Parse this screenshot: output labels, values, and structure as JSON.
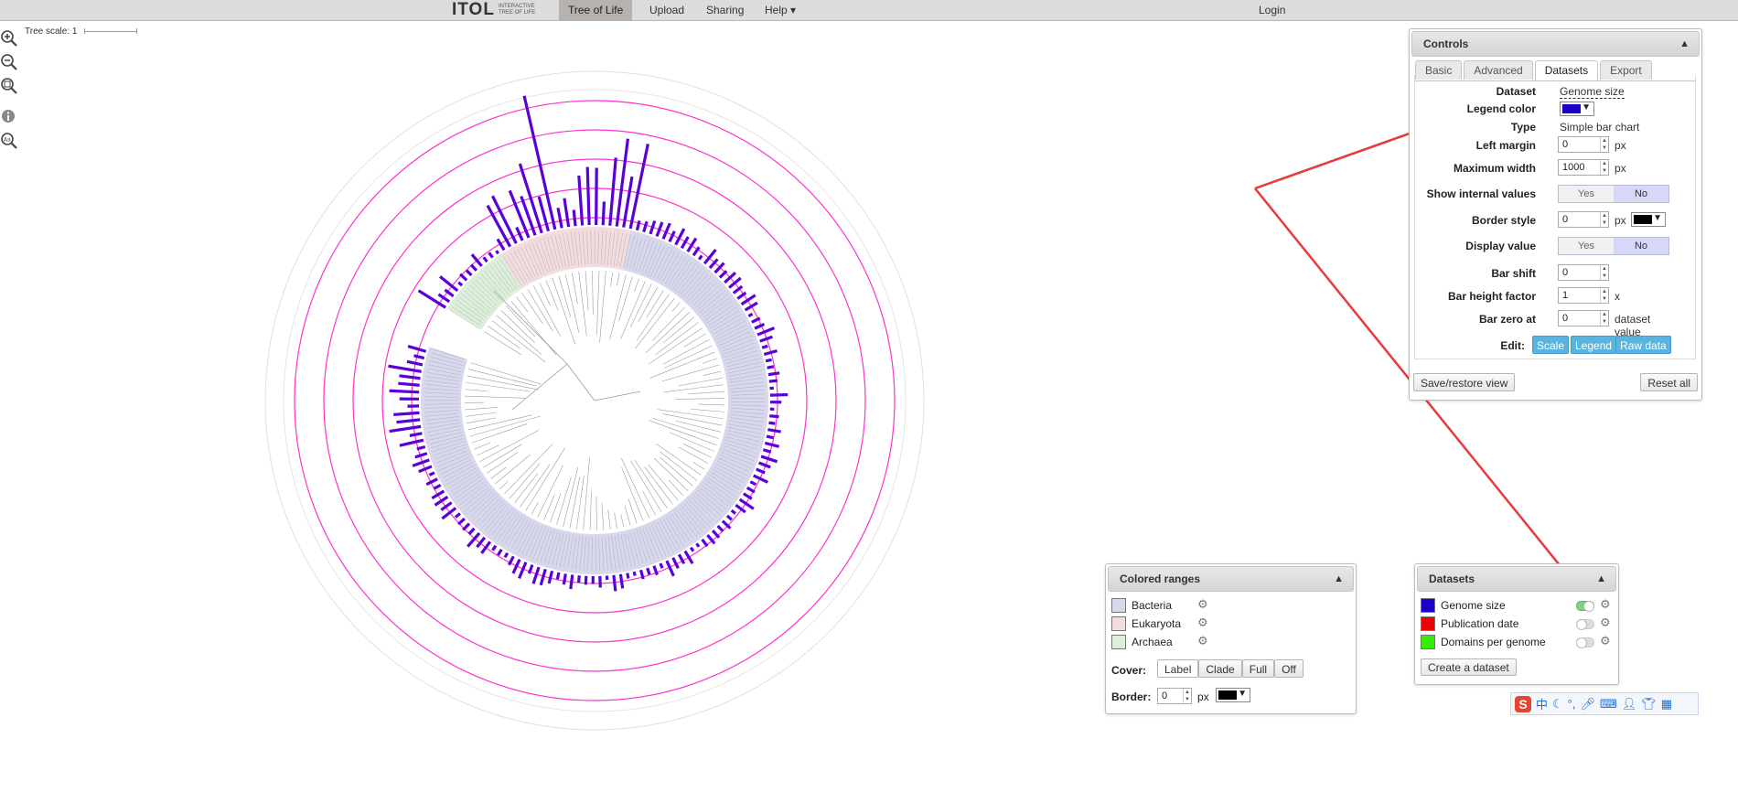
{
  "navbar": {
    "logo_main": "ITOL",
    "logo_sub_1": "INTERACTIVE",
    "logo_sub_2": "TREE OF LIFE",
    "items": [
      "Tree of Life",
      "Upload",
      "Sharing",
      "Help ▾"
    ],
    "login": "Login"
  },
  "tree": {
    "scale_label": "Tree scale: 1"
  },
  "controls": {
    "title": "Controls",
    "tabs": [
      "Basic",
      "Advanced",
      "Datasets",
      "Export"
    ],
    "active_tab": "Datasets",
    "dataset_label": "Dataset",
    "dataset_value": "Genome size",
    "legend_color_label": "Legend color",
    "type_label": "Type",
    "type_value": "Simple bar chart",
    "left_margin_label": "Left margin",
    "left_margin_value": "0",
    "max_width_label": "Maximum width",
    "max_width_value": "1000",
    "show_internal_label": "Show internal values",
    "border_style_label": "Border style",
    "border_style_value": "0",
    "display_value_label": "Display value",
    "bar_shift_label": "Bar shift",
    "bar_shift_value": "0",
    "bar_height_label": "Bar height factor",
    "bar_height_value": "1",
    "bar_zero_label": "Bar zero at",
    "bar_zero_value": "0",
    "unit_px": "px",
    "unit_x": "x",
    "unit_dataset_value": "dataset value",
    "yes": "Yes",
    "no": "No",
    "edit_label": "Edit:",
    "edit_scale": "Scale",
    "edit_legend": "Legend",
    "edit_raw": "Raw data",
    "save_restore": "Save/restore view",
    "reset_all": "Reset all"
  },
  "colored_ranges": {
    "title": "Colored ranges",
    "items": [
      {
        "label": "Bacteria",
        "color": "#d8d8ec"
      },
      {
        "label": "Eukaryota",
        "color": "#f3dcdc"
      },
      {
        "label": "Archaea",
        "color": "#dcefd8"
      }
    ],
    "cover_label": "Cover:",
    "cover_options": [
      "Label",
      "Clade",
      "Full",
      "Off"
    ],
    "cover_selected": "Label",
    "border_label": "Border:",
    "border_value": "0",
    "border_unit": "px"
  },
  "datasets": {
    "title": "Datasets",
    "items": [
      {
        "label": "Genome size",
        "color": "#1a00c8",
        "enabled": true
      },
      {
        "label": "Publication date",
        "color": "#ee0000",
        "enabled": false
      },
      {
        "label": "Domains per genome",
        "color": "#33ee00",
        "enabled": false
      }
    ],
    "create_button": "Create a dataset"
  },
  "colors": {
    "bar": "#5a00d8",
    "ring": "#ff33cc",
    "arrow": "#e83a3a"
  },
  "ime_bar": {
    "logo": "S",
    "mode": "中"
  }
}
